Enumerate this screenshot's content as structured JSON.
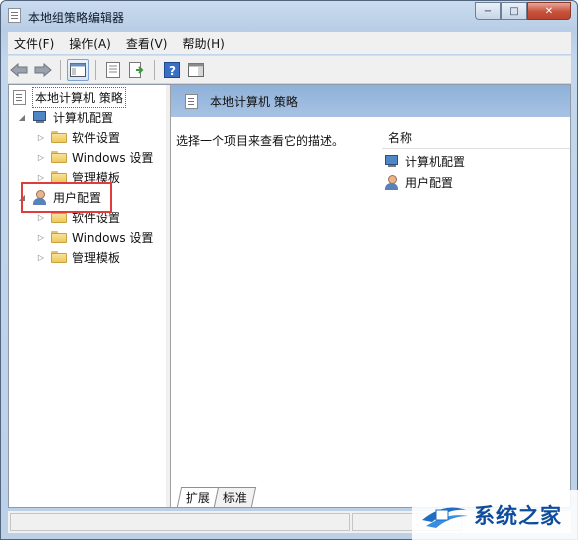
{
  "window": {
    "title": "本地组策略编辑器",
    "controls": {
      "minimize": "−",
      "maximize": "□",
      "close": "✕"
    }
  },
  "menu": [
    "文件(F)",
    "操作(A)",
    "查看(V)",
    "帮助(H)"
  ],
  "toolbar": {
    "icons": [
      "back-arrow-icon",
      "forward-arrow-icon",
      "show-hide-tree-icon",
      "properties-icon",
      "export-list-icon",
      "help-icon",
      "show-action-pane-icon"
    ],
    "help_glyph": "?"
  },
  "tree": {
    "root": "本地计算机 策略",
    "computer_config": "计算机配置",
    "computer_children": [
      "软件设置",
      "Windows 设置",
      "管理模板"
    ],
    "user_config": "用户配置",
    "user_children": [
      "软件设置",
      "Windows 设置",
      "管理模板"
    ],
    "expander_open": "◢",
    "expander_closed": "▷"
  },
  "details": {
    "header": "本地计算机 策略",
    "description": "选择一个项目来查看它的描述。",
    "column_name": "名称",
    "items": [
      "计算机配置",
      "用户配置"
    ]
  },
  "tabs": [
    "扩展",
    "标准"
  ],
  "watermark": "系统之家",
  "colors": {
    "header_blue": "#9dbbe0",
    "highlight_red": "#e03c3c",
    "watermark_blue": "#0f4c9c"
  }
}
